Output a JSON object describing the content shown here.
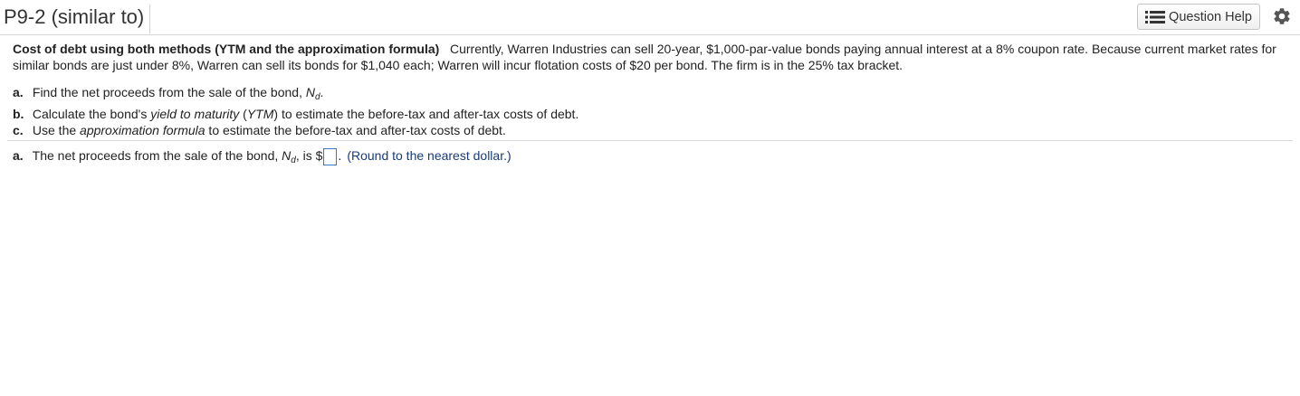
{
  "header": {
    "title": "P9-2 (similar to)",
    "help_label": "Question Help"
  },
  "question": {
    "lead": "Cost of debt using both methods (YTM and the approximation formula)",
    "body": "Currently, Warren Industries can sell 20-year, $1,000-par-value bonds paying annual interest at a 8% coupon rate.  Because current market rates for similar bonds are just under 8%, Warren can sell its bonds for $1,040 each; Warren will incur flotation costs of $20 per bond.  The firm is in the 25% tax bracket."
  },
  "parts": {
    "a": {
      "letter": "a.",
      "pre": "Find the net proceeds from the sale of the bond, ",
      "var": "N",
      "sub": "d",
      "post": "."
    },
    "b": {
      "letter": "b.",
      "pre": "Calculate the bond's ",
      "em1": "yield to maturity",
      "mid1": " (",
      "em2": "YTM",
      "post": ") to estimate the before-tax and after-tax costs of debt."
    },
    "c": {
      "letter": "c.",
      "pre": "Use the ",
      "em": "approximation formula",
      "post": " to estimate the before-tax and after-tax costs of debt."
    }
  },
  "answer": {
    "letter": "a.",
    "pre": "The net proceeds from the sale of the bond, ",
    "var": "N",
    "sub": "d",
    "mid": ", is $",
    "value": "",
    "post": ".",
    "hint": "(Round to the nearest dollar.)"
  },
  "icons": {
    "help": "list-icon",
    "settings": "gear-icon"
  }
}
